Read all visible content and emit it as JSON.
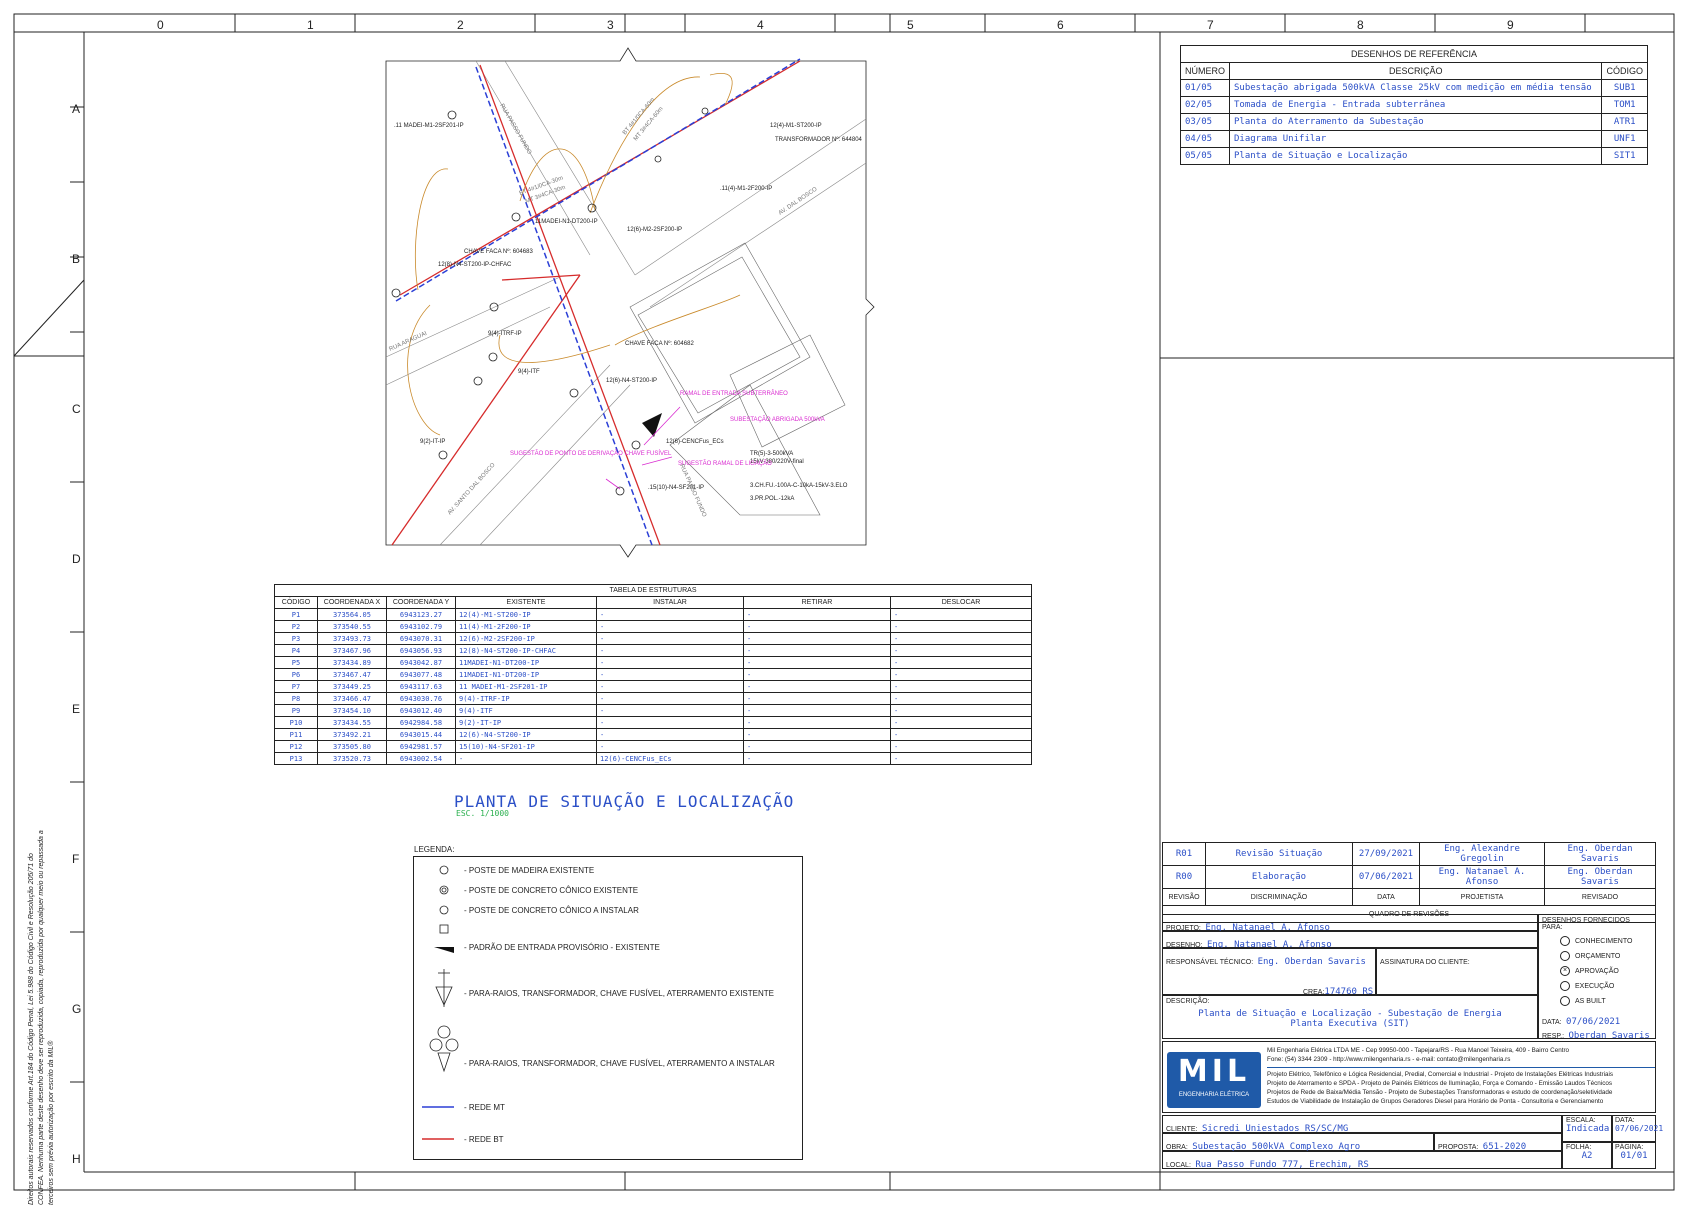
{
  "grid": {
    "columns": [
      "0",
      "1",
      "2",
      "3",
      "4",
      "5",
      "6",
      "7",
      "8",
      "9"
    ],
    "rows": [
      "A",
      "B",
      "C",
      "D",
      "E",
      "F",
      "G",
      "H"
    ]
  },
  "references": {
    "title": "DESENHOS DE REFERÊNCIA",
    "headers": [
      "NÚMERO",
      "DESCRIÇÃO",
      "CÓDIGO"
    ],
    "rows": [
      [
        "01/05",
        "Subestação abrigada 500kVA Classe 25kV com medição em média tensão",
        "SUB1"
      ],
      [
        "02/05",
        "Tomada de Energia - Entrada subterrânea",
        "TOM1"
      ],
      [
        "03/05",
        "Planta do Aterramento da Subestação",
        "ATR1"
      ],
      [
        "04/05",
        "Diagrama Unifilar",
        "UNF1"
      ],
      [
        "05/05",
        "Planta de Situação e Localização",
        "SIT1"
      ]
    ]
  },
  "map": {
    "labels": {
      "p7": ".11 MADEI-M1-2SF201-IP",
      "p1": "12(4)-M1-ST200-IP",
      "transformer": "TRANSFORMADOR Nº: 644804",
      "p2": ".11(4)-M1-2F200-IP",
      "p3": "12(6)-M2-2SF200-IP",
      "p6": "11MADEI-N1-DT200-IP",
      "switch1": "CHAVE FACA Nº: 604683",
      "p4": "12(8)-N4-ST200-IP-CHFAC",
      "p5": ".11MADEI-M1-DT200-IP",
      "p8": "9(4)-ITRF-IP",
      "p9": "9(4)-ITF",
      "p10": "9(2)-IT-IP",
      "switch2": "CHAVE FACA Nº: 604682",
      "p11": "12(6)-N4-ST200-IP",
      "p13": "12(6)-CENCFus_ECs",
      "p12": ".15(10)-N4-SF201-IP",
      "ramal": "RAMAL DE ENTRADA SUBTERRÂNEO",
      "subst": "SUBESTAÇÃO ABRIGADA 500kVA",
      "sugestao1": "SUGESTÃO DE PONTO DE DERIVAÇÃO CHAVE FUSÍVEL",
      "sugestao2": "SUGESTÃO RAMAL DE LIGAÇÃO",
      "tr1": "TR(5)-3-500kVA",
      "tr2": "15kV-380/220V-final",
      "chfu": "3.CH.FU.-100A-C-10kA-15kV-3.ELO",
      "pr": "3.PR.POL.-12kA",
      "street1": "RUA PASSO FUNDO",
      "street2": "AV. DAL BOSCO",
      "street3": "AV. SANTO DAL BOSCO",
      "street4": "RUA ARAGUAI",
      "street5": "RUA PASSO FUNDO",
      "bt1": "BT 4#1/0CA-60m",
      "bt2": "MT 3#4CA-60m",
      "bt3": "BT 4#1/0CA-30m",
      "bt4": "MT 3#4CA-30m"
    }
  },
  "structures": {
    "title": "TABELA DE ESTRUTURAS",
    "headers": [
      "CÓDIGO",
      "COORDENADA X",
      "COORDENADA Y",
      "EXISTENTE",
      "INSTALAR",
      "RETIRAR",
      "DESLOCAR"
    ],
    "rows": [
      [
        "P1",
        "373564.05",
        "6943123.27",
        "12(4)-M1-ST200-IP",
        "-",
        "-",
        "-"
      ],
      [
        "P2",
        "373540.55",
        "6943102.79",
        "11(4)-M1-2F200-IP",
        "-",
        "-",
        "-"
      ],
      [
        "P3",
        "373493.73",
        "6943070.31",
        "12(6)-M2-2SF200-IP",
        "-",
        "-",
        "-"
      ],
      [
        "P4",
        "373467.96",
        "6943056.93",
        "12(8)-N4-ST200-IP-CHFAC",
        "-",
        "-",
        "-"
      ],
      [
        "P5",
        "373434.89",
        "6943042.87",
        "11MADEI-N1-DT200-IP",
        "-",
        "-",
        "-"
      ],
      [
        "P6",
        "373467.47",
        "6943077.48",
        "11MADEI-N1-DT200-IP",
        "-",
        "-",
        "-"
      ],
      [
        "P7",
        "373449.25",
        "6943117.63",
        "11 MADEI-M1-2SF201-IP",
        "-",
        "-",
        "-"
      ],
      [
        "P8",
        "373466.47",
        "6943030.76",
        "9(4)-ITRF-IP",
        "-",
        "-",
        "-"
      ],
      [
        "P9",
        "373454.10",
        "6943012.40",
        "9(4)-ITF",
        "-",
        "-",
        "-"
      ],
      [
        "P10",
        "373434.55",
        "6942984.58",
        "9(2)-IT-IP",
        "-",
        "-",
        "-"
      ],
      [
        "P11",
        "373492.21",
        "6943015.44",
        "12(6)-N4-ST200-IP",
        "-",
        "-",
        "-"
      ],
      [
        "P12",
        "373505.80",
        "6942981.57",
        "15(10)-N4-SF201-IP",
        "-",
        "-",
        "-"
      ],
      [
        "P13",
        "373520.73",
        "6943002.54",
        "-",
        "12(6)-CENCFus_ECs",
        "-",
        "-"
      ]
    ]
  },
  "plan": {
    "title": "PLANTA DE SITUAÇÃO E LOCALIZAÇÃO",
    "scale": "ESC. 1/1000"
  },
  "legend": {
    "title": "LEGENDA:",
    "items": [
      "- POSTE DE MADEIRA EXISTENTE",
      "- POSTE DE CONCRETO CÔNICO EXISTENTE",
      "- POSTE DE CONCRETO CÔNICO A INSTALAR",
      "- PADRÃO DE ENTRADA PROVISÓRIO - EXISTENTE",
      "- PARA-RAIOS, TRANSFORMADOR, CHAVE FUSÍVEL, ATERRAMENTO EXISTENTE",
      "- PARA-RAIOS, TRANSFORMADOR, CHAVE FUSÍVEL, ATERRAMENTO A INSTALAR",
      "- REDE MT",
      "- REDE BT"
    ],
    "colors": {
      "mt": "#2b3fd6",
      "bt": "#d62b2b"
    }
  },
  "revisions": {
    "rows": [
      [
        "R01",
        "Revisão Situação",
        "27/09/2021",
        "Eng. Alexandre Gregolin",
        "Eng. Oberdan Savaris"
      ],
      [
        "R00",
        "Elaboração",
        "07/06/2021",
        "Eng. Natanael A. Afonso",
        "Eng. Oberdan Savaris"
      ]
    ],
    "headers": [
      "REVISÃO",
      "DISCRIMINAÇÃO",
      "DATA",
      "PROJETISTA",
      "REVISADO"
    ],
    "title": "QUADRO DE REVISÕES"
  },
  "titleblock": {
    "projeto_label": "PROJETO:",
    "projeto": "Eng. Natanael A. Afonso",
    "desenho_label": "DESENHO:",
    "desenho": "Eng. Natanael A. Afonso",
    "resp_label": "RESPONSÁVEL TÉCNICO:",
    "resp": "Eng. Oberdan Savaris",
    "crea_label": "CREA:",
    "crea": "174760 RS",
    "assinatura_label": "ASSINATURA DO CLIENTE:",
    "descricao_label": "DESCRIÇÃO:",
    "descricao1": "Planta de Situação e Localização - Subestação de Energia",
    "descricao2": "Planta Executiva (SIT)",
    "fornecidos_title": "DESENHOS FORNECIDOS PARA:",
    "fornecidos": [
      "CONHECIMENTO",
      "ORÇAMENTO",
      "APROVAÇÃO",
      "EXECUÇÃO",
      "AS BUILT"
    ],
    "selected": "APROVAÇÃO",
    "data_label": "DATA:",
    "data": "07/06/2021",
    "resp2_label": "RESP.:",
    "resp2": "Oberdan Savaris",
    "company_line1": "Mil Engenharia Elétrica LTDA ME - Cep 99950-000 - Tapejara/RS - Rua Manoel Teixeira, 409 - Bairro Centro",
    "company_line2": "Fone: (54) 3344 2309 - http://www.milengenharia.rs - e-mail: contato@milengenharia.rs",
    "services1": "Projeto Elétrico, Telefônico e Lógica Residencial, Predial, Comercial e Industrial - Projeto de Instalações Elétricas Industriais",
    "services2": "Projeto de Aterramento e SPDA - Projeto de Painéis Elétricos de Iluminação, Força e Comando - Emissão Laudos Técnicos",
    "services3": "Projetos de Rede de Baixa/Média Tensão - Projeto de Subestações Transformadoras e estudo de coordenação/seletividade",
    "services4": "Estudos de Viabilidade de Instalação de Grupos Geradores Diesel para Horário de Ponta - Consultoria e Gerenciamento",
    "logo_text": "MIL",
    "logo_sub": "ENGENHARIA ELÉTRICA",
    "cliente_label": "CLIENTE:",
    "cliente": "Sicredi Uniestados RS/SC/MG",
    "obra_label": "OBRA:",
    "obra": "Subestação 500kVA Complexo Agro",
    "proposta_label": "PROPOSTA:",
    "proposta": "651-2020",
    "local_label": "LOCAL:",
    "local": "Rua Passo Fundo 777, Erechim, RS",
    "escala_label": "ESCALA:",
    "escala": "Indicada",
    "data2_label": "DATA:",
    "data2": "07/06/2021",
    "folha_label": "FOLHA:",
    "folha": "A2",
    "pagina_label": "PÁGINA:",
    "pagina": "01/01"
  },
  "copyright": "Direitos autorais reservados conforme Art.184 do Código Penal, Lei 5.988 do Código Civil e Resolução 205/71 do CONFEA. Nenhuma parte deste desenho deve ser reproduzida, copiada, reproduzida por qualquer meio ou repassada a terceiros sem prévia autorização por escrito da MIL®"
}
